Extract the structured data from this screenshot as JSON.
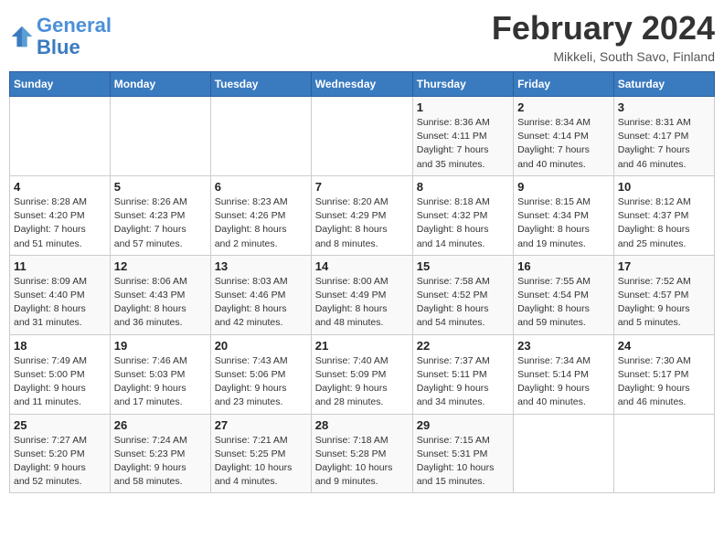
{
  "logo": {
    "line1": "General",
    "line2": "Blue"
  },
  "title": "February 2024",
  "location": "Mikkeli, South Savo, Finland",
  "days_of_week": [
    "Sunday",
    "Monday",
    "Tuesday",
    "Wednesday",
    "Thursday",
    "Friday",
    "Saturday"
  ],
  "weeks": [
    [
      {
        "day": "",
        "info": ""
      },
      {
        "day": "",
        "info": ""
      },
      {
        "day": "",
        "info": ""
      },
      {
        "day": "",
        "info": ""
      },
      {
        "day": "1",
        "info": "Sunrise: 8:36 AM\nSunset: 4:11 PM\nDaylight: 7 hours\nand 35 minutes."
      },
      {
        "day": "2",
        "info": "Sunrise: 8:34 AM\nSunset: 4:14 PM\nDaylight: 7 hours\nand 40 minutes."
      },
      {
        "day": "3",
        "info": "Sunrise: 8:31 AM\nSunset: 4:17 PM\nDaylight: 7 hours\nand 46 minutes."
      }
    ],
    [
      {
        "day": "4",
        "info": "Sunrise: 8:28 AM\nSunset: 4:20 PM\nDaylight: 7 hours\nand 51 minutes."
      },
      {
        "day": "5",
        "info": "Sunrise: 8:26 AM\nSunset: 4:23 PM\nDaylight: 7 hours\nand 57 minutes."
      },
      {
        "day": "6",
        "info": "Sunrise: 8:23 AM\nSunset: 4:26 PM\nDaylight: 8 hours\nand 2 minutes."
      },
      {
        "day": "7",
        "info": "Sunrise: 8:20 AM\nSunset: 4:29 PM\nDaylight: 8 hours\nand 8 minutes."
      },
      {
        "day": "8",
        "info": "Sunrise: 8:18 AM\nSunset: 4:32 PM\nDaylight: 8 hours\nand 14 minutes."
      },
      {
        "day": "9",
        "info": "Sunrise: 8:15 AM\nSunset: 4:34 PM\nDaylight: 8 hours\nand 19 minutes."
      },
      {
        "day": "10",
        "info": "Sunrise: 8:12 AM\nSunset: 4:37 PM\nDaylight: 8 hours\nand 25 minutes."
      }
    ],
    [
      {
        "day": "11",
        "info": "Sunrise: 8:09 AM\nSunset: 4:40 PM\nDaylight: 8 hours\nand 31 minutes."
      },
      {
        "day": "12",
        "info": "Sunrise: 8:06 AM\nSunset: 4:43 PM\nDaylight: 8 hours\nand 36 minutes."
      },
      {
        "day": "13",
        "info": "Sunrise: 8:03 AM\nSunset: 4:46 PM\nDaylight: 8 hours\nand 42 minutes."
      },
      {
        "day": "14",
        "info": "Sunrise: 8:00 AM\nSunset: 4:49 PM\nDaylight: 8 hours\nand 48 minutes."
      },
      {
        "day": "15",
        "info": "Sunrise: 7:58 AM\nSunset: 4:52 PM\nDaylight: 8 hours\nand 54 minutes."
      },
      {
        "day": "16",
        "info": "Sunrise: 7:55 AM\nSunset: 4:54 PM\nDaylight: 8 hours\nand 59 minutes."
      },
      {
        "day": "17",
        "info": "Sunrise: 7:52 AM\nSunset: 4:57 PM\nDaylight: 9 hours\nand 5 minutes."
      }
    ],
    [
      {
        "day": "18",
        "info": "Sunrise: 7:49 AM\nSunset: 5:00 PM\nDaylight: 9 hours\nand 11 minutes."
      },
      {
        "day": "19",
        "info": "Sunrise: 7:46 AM\nSunset: 5:03 PM\nDaylight: 9 hours\nand 17 minutes."
      },
      {
        "day": "20",
        "info": "Sunrise: 7:43 AM\nSunset: 5:06 PM\nDaylight: 9 hours\nand 23 minutes."
      },
      {
        "day": "21",
        "info": "Sunrise: 7:40 AM\nSunset: 5:09 PM\nDaylight: 9 hours\nand 28 minutes."
      },
      {
        "day": "22",
        "info": "Sunrise: 7:37 AM\nSunset: 5:11 PM\nDaylight: 9 hours\nand 34 minutes."
      },
      {
        "day": "23",
        "info": "Sunrise: 7:34 AM\nSunset: 5:14 PM\nDaylight: 9 hours\nand 40 minutes."
      },
      {
        "day": "24",
        "info": "Sunrise: 7:30 AM\nSunset: 5:17 PM\nDaylight: 9 hours\nand 46 minutes."
      }
    ],
    [
      {
        "day": "25",
        "info": "Sunrise: 7:27 AM\nSunset: 5:20 PM\nDaylight: 9 hours\nand 52 minutes."
      },
      {
        "day": "26",
        "info": "Sunrise: 7:24 AM\nSunset: 5:23 PM\nDaylight: 9 hours\nand 58 minutes."
      },
      {
        "day": "27",
        "info": "Sunrise: 7:21 AM\nSunset: 5:25 PM\nDaylight: 10 hours\nand 4 minutes."
      },
      {
        "day": "28",
        "info": "Sunrise: 7:18 AM\nSunset: 5:28 PM\nDaylight: 10 hours\nand 9 minutes."
      },
      {
        "day": "29",
        "info": "Sunrise: 7:15 AM\nSunset: 5:31 PM\nDaylight: 10 hours\nand 15 minutes."
      },
      {
        "day": "",
        "info": ""
      },
      {
        "day": "",
        "info": ""
      }
    ]
  ]
}
